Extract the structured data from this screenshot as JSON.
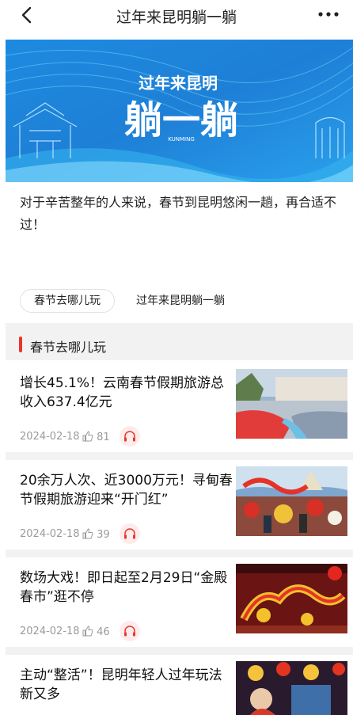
{
  "header": {
    "title": "过年来昆明躺一躺"
  },
  "banner": {
    "line1": "过年来昆明",
    "line2": "躺一躺",
    "sub": "KUNMING"
  },
  "intro": "对于辛苦整年的人来说，春节到昆明悠闲一趟，再合适不过！",
  "tags": [
    "春节去哪儿玩",
    "过年来昆明躺一躺"
  ],
  "section": {
    "title": "春节去哪儿玩"
  },
  "articles": [
    {
      "title": "增长45.1%！云南春节假期旅游总收入637.4亿元",
      "date": "2024-02-18",
      "likes": "81"
    },
    {
      "title": "20余万人次、近3000万元！寻甸春节假期旅游迎来“开门红”",
      "date": "2024-02-18",
      "likes": "39"
    },
    {
      "title": "数场大戏！即日起至2月29日“金殿春市”逛不停",
      "date": "2024-02-18",
      "likes": "46"
    },
    {
      "title": "主动“整活”！昆明年轻人过年玩法新又多"
    }
  ],
  "colors": {
    "accent": "#e8362c",
    "banner_blue": "#1e7fd6"
  },
  "icons": [
    "back-icon",
    "more-icon",
    "like-icon",
    "headphones-icon"
  ]
}
